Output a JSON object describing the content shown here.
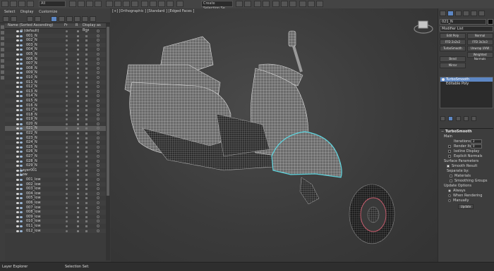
{
  "toolbar": {
    "layer_combo": "All",
    "selection_set": "Create Selection Se"
  },
  "menu": {
    "items": [
      "Select",
      "Display",
      "Customize"
    ]
  },
  "explorer": {
    "col_name": "Name (Sorted Ascending)",
    "col_fr": "Fr",
    "col_r": "R",
    "col_display": "Display as Box",
    "rows": [
      {
        "label": "0 (default)",
        "kind": "layer",
        "indent": 5
      },
      {
        "label": "001_N",
        "kind": "obj"
      },
      {
        "label": "002_N",
        "kind": "obj"
      },
      {
        "label": "003_N",
        "kind": "obj"
      },
      {
        "label": "004_N",
        "kind": "obj"
      },
      {
        "label": "005_N",
        "kind": "obj"
      },
      {
        "label": "006_N",
        "kind": "obj"
      },
      {
        "label": "007_N",
        "kind": "obj"
      },
      {
        "label": "008_N",
        "kind": "obj"
      },
      {
        "label": "009_N",
        "kind": "obj"
      },
      {
        "label": "010_N",
        "kind": "obj"
      },
      {
        "label": "011_N",
        "kind": "obj"
      },
      {
        "label": "012_N",
        "kind": "obj"
      },
      {
        "label": "013_N",
        "kind": "obj"
      },
      {
        "label": "014_N",
        "kind": "obj"
      },
      {
        "label": "015_N",
        "kind": "obj"
      },
      {
        "label": "016_N",
        "kind": "obj"
      },
      {
        "label": "017_N",
        "kind": "obj"
      },
      {
        "label": "018_N",
        "kind": "obj"
      },
      {
        "label": "019_N",
        "kind": "obj"
      },
      {
        "label": "020_N",
        "kind": "obj"
      },
      {
        "label": "021_N",
        "kind": "obj",
        "selected": true
      },
      {
        "label": "022_N",
        "kind": "obj"
      },
      {
        "label": "023_N",
        "kind": "obj"
      },
      {
        "label": "024_N",
        "kind": "obj"
      },
      {
        "label": "025_N",
        "kind": "obj"
      },
      {
        "label": "026_N",
        "kind": "obj"
      },
      {
        "label": "027_N",
        "kind": "obj"
      },
      {
        "label": "028_N",
        "kind": "obj"
      },
      {
        "label": "029_N",
        "kind": "obj"
      },
      {
        "label": "Layer001",
        "kind": "layer"
      },
      {
        "label": "Low",
        "kind": "layer"
      },
      {
        "label": "001_low",
        "kind": "obj"
      },
      {
        "label": "002_low",
        "kind": "obj"
      },
      {
        "label": "003_low",
        "kind": "obj"
      },
      {
        "label": "004_low",
        "kind": "obj"
      },
      {
        "label": "005_low",
        "kind": "obj"
      },
      {
        "label": "006_low",
        "kind": "obj"
      },
      {
        "label": "007_low",
        "kind": "obj"
      },
      {
        "label": "008_low",
        "kind": "obj"
      },
      {
        "label": "009_low",
        "kind": "obj"
      },
      {
        "label": "010_low",
        "kind": "obj"
      },
      {
        "label": "011_low",
        "kind": "obj"
      },
      {
        "label": "012_low",
        "kind": "obj"
      }
    ]
  },
  "viewport": {
    "label": "[+] [Orthographic ] [Standard ] [Edged Faces ]"
  },
  "statusbar": {
    "explorer_label": "Layer Explorer",
    "selection_label": "Selection Set:"
  },
  "cmdpanel": {
    "object_name": "021_N",
    "modifier_list": "Modifier List",
    "buttons": [
      "Edit Poly",
      "Normal",
      "FFD 2x2x2",
      "FFD 3x3x3",
      "TurboSmooth",
      "Unwrap UVW",
      "Bend",
      "Weighted Normals",
      "Mirror"
    ],
    "stack": [
      "TurboSmooth",
      "Editable Poly"
    ],
    "ts": {
      "title": "TurboSmooth",
      "main": "Main",
      "iterations_label": "Iterations:",
      "iterations_value": "2",
      "render_iters_label": "Render Iters:",
      "render_iters_value": "0",
      "isoline": "Isoline Display",
      "explicit": "Explicit Normals",
      "surface": "Surface Parameters",
      "smooth_result": "Smooth Result",
      "separate_by": "Separate by:",
      "materials": "Materials",
      "smoothing_groups": "Smoothing Groups",
      "update_options": "Update Options",
      "always": "Always",
      "when_rendering": "When Rendering",
      "manually": "Manually",
      "update": "Update"
    }
  }
}
